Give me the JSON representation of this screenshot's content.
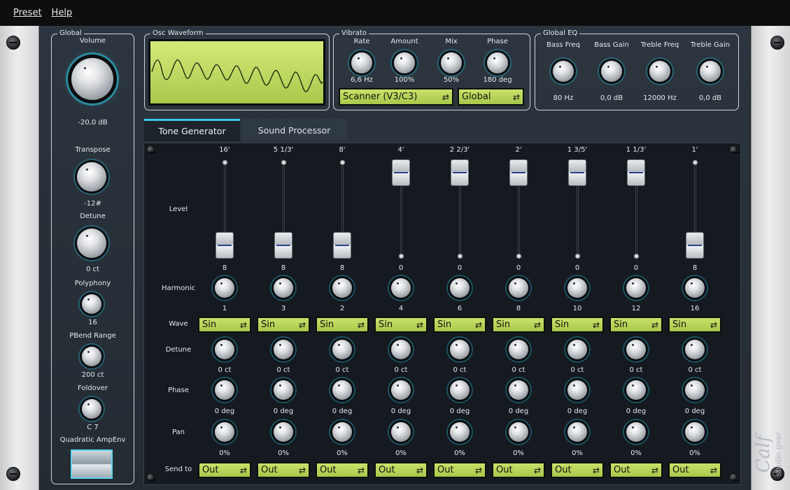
{
  "menu": {
    "preset": "Preset",
    "help": "Help"
  },
  "global": {
    "title": "Global",
    "volume": {
      "label": "Volume",
      "value": "-20,0 dB"
    },
    "transpose": {
      "label": "Transpose",
      "value": "-12#"
    },
    "detune": {
      "label": "Detune",
      "value": "0 ct"
    },
    "polyphony": {
      "label": "Polyphony",
      "value": "16"
    },
    "pbend": {
      "label": "PBend Range",
      "value": "200 ct"
    },
    "foldover": {
      "label": "Foldover",
      "value": "C 7"
    },
    "ampenv": {
      "label": "Quadratic AmpEnv"
    }
  },
  "osc": {
    "title": "Osc Waveform"
  },
  "vibrato": {
    "title": "Vibrato",
    "knobs": [
      {
        "label": "Rate",
        "value": "6,6 Hz"
      },
      {
        "label": "Amount",
        "value": "100%"
      },
      {
        "label": "Mix",
        "value": "50%"
      },
      {
        "label": "Phase",
        "value": "180 deg"
      }
    ],
    "mode": "Scanner (V3/C3)",
    "scope": "Global"
  },
  "eq": {
    "title": "Global EQ",
    "knobs": [
      {
        "label": "Bass Freq",
        "value": "80 Hz"
      },
      {
        "label": "Bass Gain",
        "value": "0,0 dB"
      },
      {
        "label": "Treble Freq",
        "value": "12000 Hz"
      },
      {
        "label": "Treble Gain",
        "value": "0,0 dB"
      }
    ]
  },
  "tabs": [
    "Tone Generator",
    "Sound Processor"
  ],
  "rows": {
    "level": "Level",
    "harmonic": "Harmonic",
    "wave": "Wave",
    "detune": "Detune",
    "phase": "Phase",
    "pan": "Pan",
    "sendto": "Send to"
  },
  "drawbars": [
    {
      "footage": "16'",
      "level": "8",
      "harmonic": "1",
      "wave": "Sin",
      "detune": "0 ct",
      "phase": "0 deg",
      "pan": "0%",
      "send": "Out",
      "up": false
    },
    {
      "footage": "5 1/3'",
      "level": "8",
      "harmonic": "3",
      "wave": "Sin",
      "detune": "0 ct",
      "phase": "0 deg",
      "pan": "0%",
      "send": "Out",
      "up": false
    },
    {
      "footage": "8'",
      "level": "8",
      "harmonic": "2",
      "wave": "Sin",
      "detune": "0 ct",
      "phase": "0 deg",
      "pan": "0%",
      "send": "Out",
      "up": false
    },
    {
      "footage": "4'",
      "level": "0",
      "harmonic": "4",
      "wave": "Sin",
      "detune": "0 ct",
      "phase": "0 deg",
      "pan": "0%",
      "send": "Out",
      "up": true
    },
    {
      "footage": "2 2/3'",
      "level": "0",
      "harmonic": "6",
      "wave": "Sin",
      "detune": "0 ct",
      "phase": "0 deg",
      "pan": "0%",
      "send": "Out",
      "up": true
    },
    {
      "footage": "2'",
      "level": "0",
      "harmonic": "8",
      "wave": "Sin",
      "detune": "0 ct",
      "phase": "0 deg",
      "pan": "0%",
      "send": "Out",
      "up": true
    },
    {
      "footage": "1 3/5'",
      "level": "0",
      "harmonic": "10",
      "wave": "Sin",
      "detune": "0 ct",
      "phase": "0 deg",
      "pan": "0%",
      "send": "Out",
      "up": true
    },
    {
      "footage": "1 1/3'",
      "level": "0",
      "harmonic": "12",
      "wave": "Sin",
      "detune": "0 ct",
      "phase": "0 deg",
      "pan": "0%",
      "send": "Out",
      "up": true
    },
    {
      "footage": "1'",
      "level": "8",
      "harmonic": "16",
      "wave": "Sin",
      "detune": "0 ct",
      "phase": "0 deg",
      "pan": "0%",
      "send": "Out",
      "up": false
    }
  ],
  "logo": {
    "brand": "Calf",
    "sub": "studio gear"
  },
  "colors": {
    "accent": "#37c6e6",
    "lcd": "#b6d456"
  }
}
